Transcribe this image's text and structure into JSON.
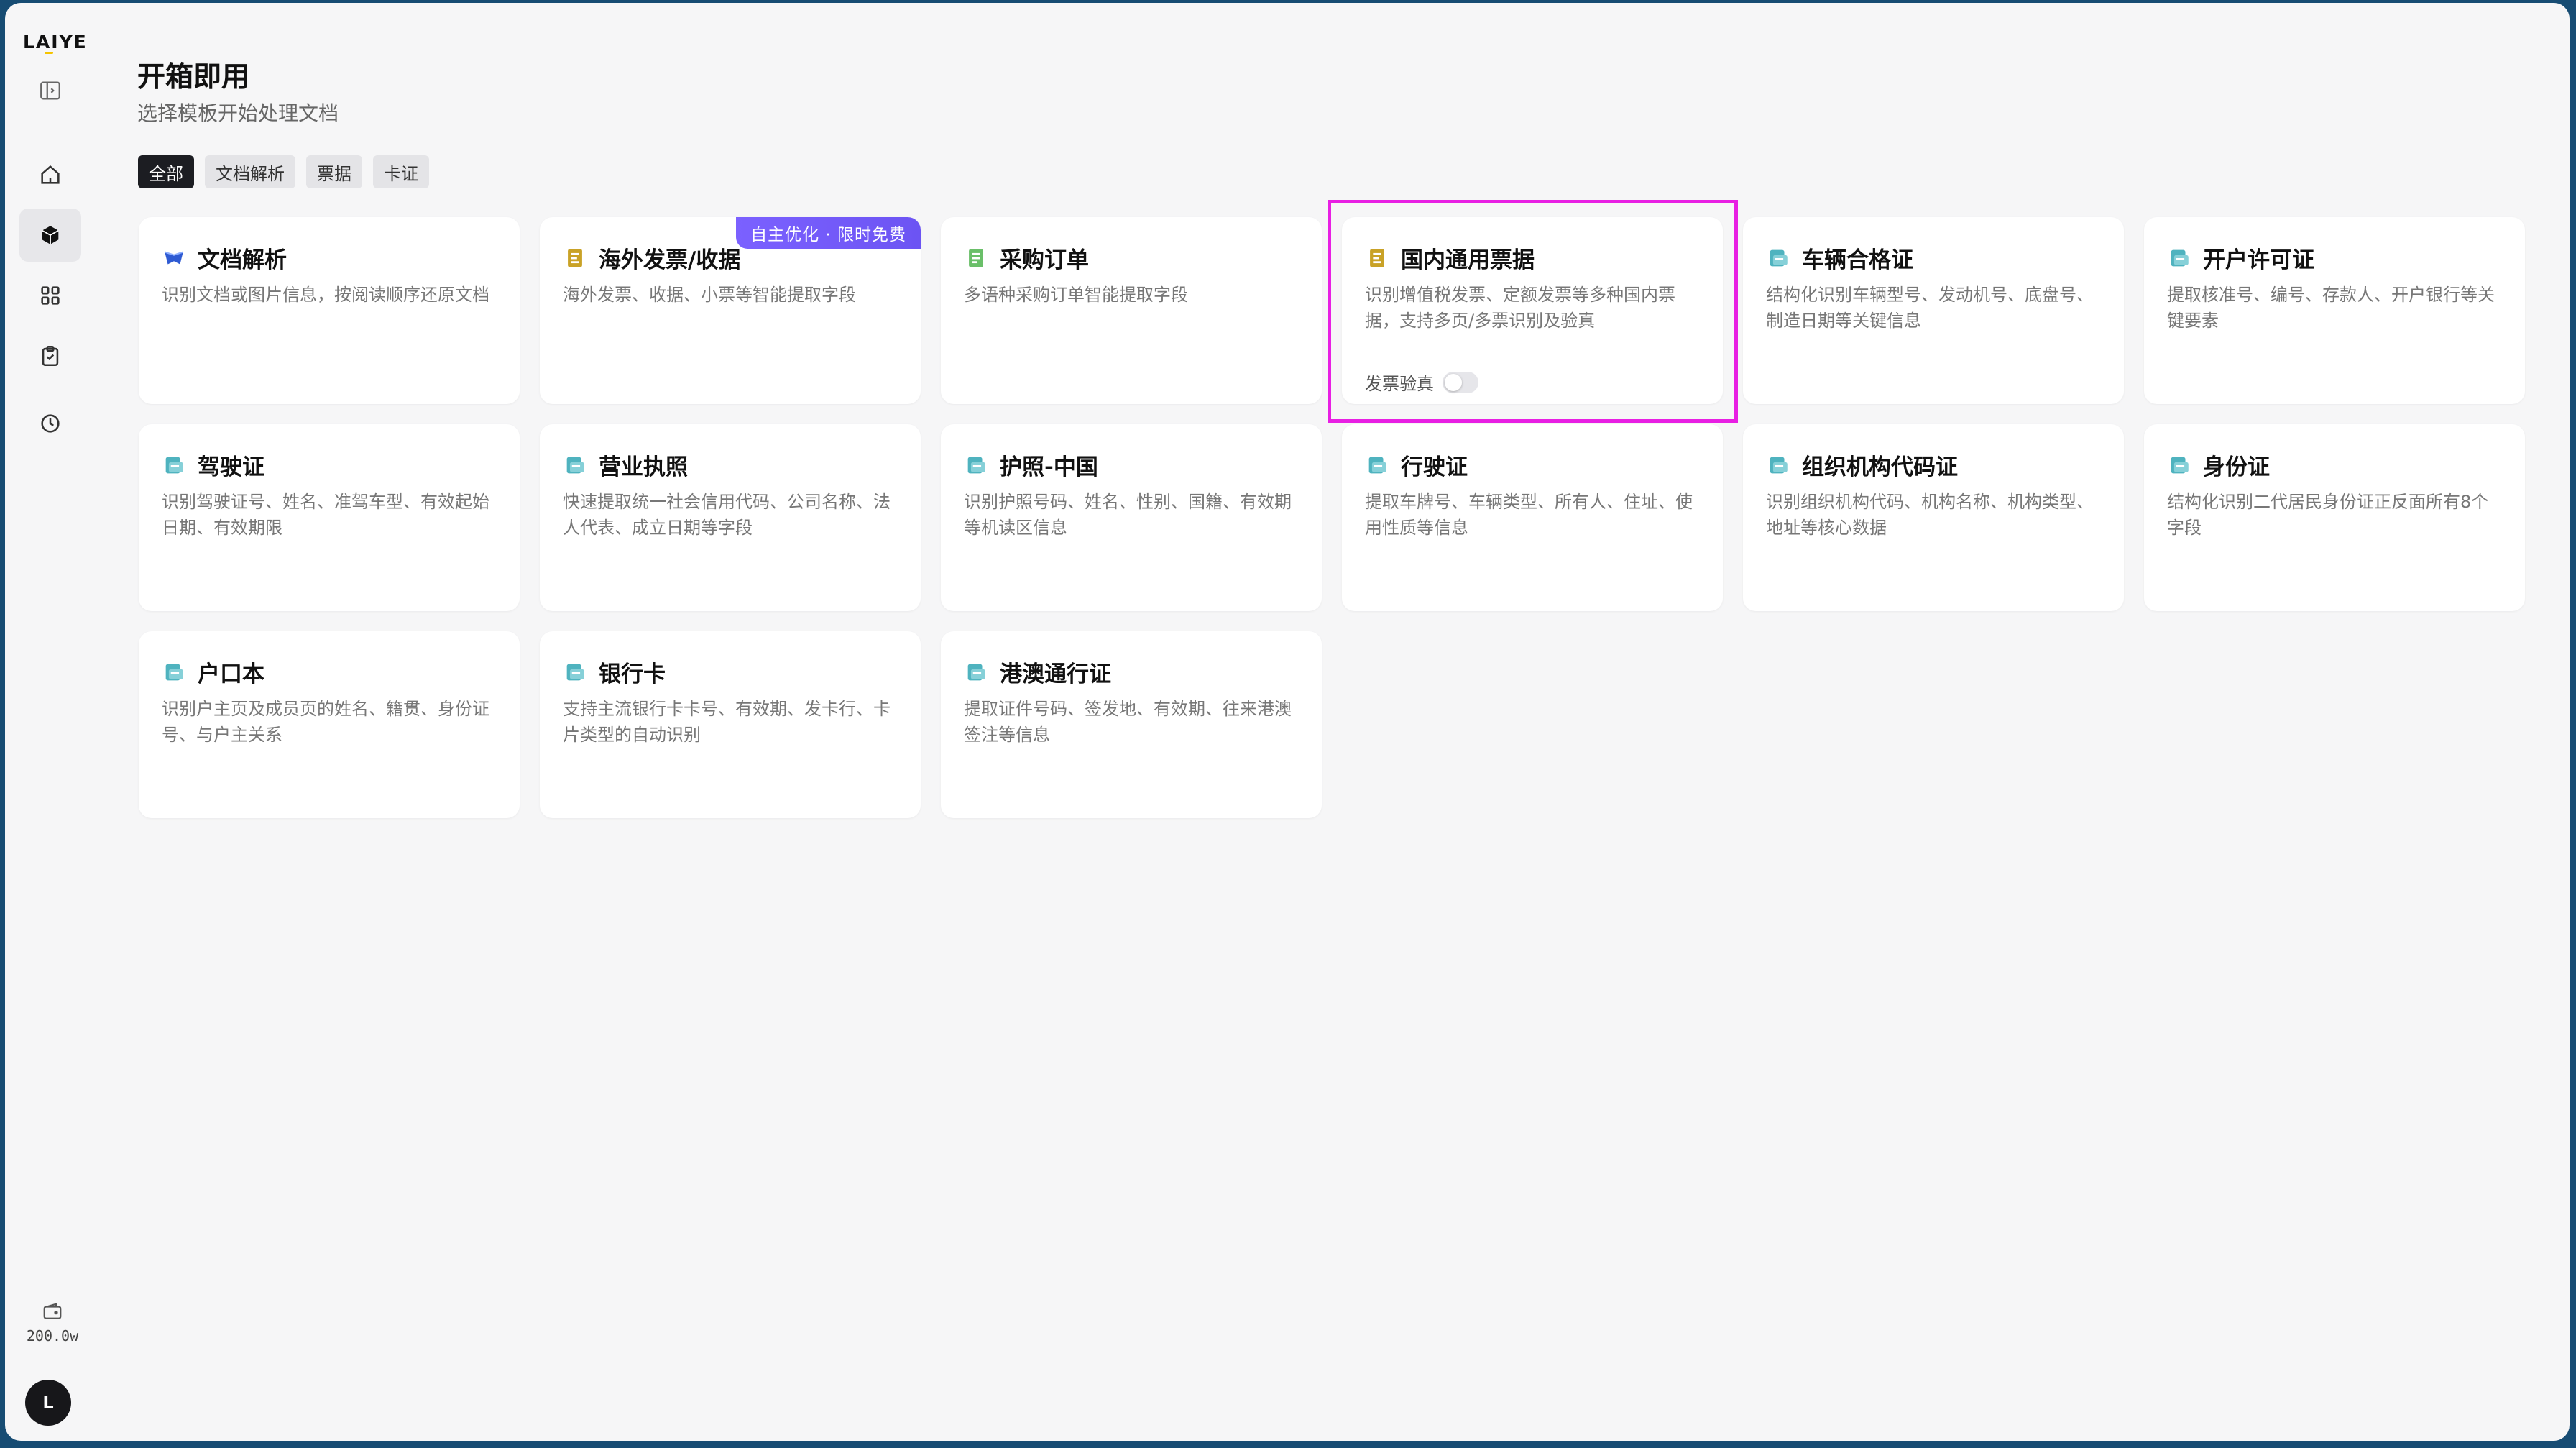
{
  "app": {
    "logo": "LAIYE"
  },
  "sidebar": {
    "items": [
      {
        "icon": "panel-toggle-icon"
      },
      {
        "icon": "home-icon"
      },
      {
        "icon": "cube-icon",
        "active": true
      },
      {
        "icon": "grid-icon"
      },
      {
        "icon": "clipboard-check-icon"
      },
      {
        "icon": "clock-icon"
      }
    ],
    "wallet_amount": "200.0w",
    "avatar_letter": "L"
  },
  "header": {
    "title": "开箱即用",
    "subtitle": "选择模板开始处理文档"
  },
  "filters": [
    "全部",
    "文档解析",
    "票据",
    "卡证"
  ],
  "active_filter": "全部",
  "cards": [
    {
      "title": "文档解析",
      "desc": "识别文档或图片信息，按阅读顺序还原文档",
      "icon": "document-parse-icon"
    },
    {
      "title": "海外发票/收据",
      "desc": "海外发票、收据、小票等智能提取字段",
      "icon": "invoice-icon",
      "badge": "自主优化 · 限时免费"
    },
    {
      "title": "采购订单",
      "desc": "多语种采购订单智能提取字段",
      "icon": "purchase-order-icon"
    },
    {
      "title": "国内通用票据",
      "desc": "识别增值税发票、定额发票等多种国内票据，支持多页/多票识别及验真",
      "icon": "invoice-icon",
      "toggle_label": "发票验真",
      "toggle_on": false
    },
    {
      "title": "车辆合格证",
      "desc": "结构化识别车辆型号、发动机号、底盘号、制造日期等关键信息",
      "icon": "card-icon"
    },
    {
      "title": "开户许可证",
      "desc": "提取核准号、编号、存款人、开户银行等关键要素",
      "icon": "card-icon"
    },
    {
      "title": "驾驶证",
      "desc": "识别驾驶证号、姓名、准驾车型、有效起始日期、有效期限",
      "icon": "card-icon"
    },
    {
      "title": "营业执照",
      "desc": "快速提取统一社会信用代码、公司名称、法人代表、成立日期等字段",
      "icon": "card-icon"
    },
    {
      "title": "护照-中国",
      "desc": "识别护照号码、姓名、性别、国籍、有效期等机读区信息",
      "icon": "card-icon"
    },
    {
      "title": "行驶证",
      "desc": "提取车牌号、车辆类型、所有人、住址、使用性质等信息",
      "icon": "card-icon"
    },
    {
      "title": "组织机构代码证",
      "desc": "识别组织机构代码、机构名称、机构类型、地址等核心数据",
      "icon": "card-icon"
    },
    {
      "title": "身份证",
      "desc": "结构化识别二代居民身份证正反面所有8个字段",
      "icon": "card-icon"
    },
    {
      "title": "户口本",
      "desc": "识别户主页及成员页的姓名、籍贯、身份证号、与户主关系",
      "icon": "card-icon"
    },
    {
      "title": "银行卡",
      "desc": "支持主流银行卡卡号、有效期、发卡行、卡片类型的自动识别",
      "icon": "card-icon"
    },
    {
      "title": "港澳通行证",
      "desc": "提取证件号码、签发地、有效期、往来港澳签注等信息",
      "icon": "card-icon"
    }
  ],
  "colors": {
    "accent_badge": "#7b61ff",
    "highlight": "#e81fe3",
    "card_icon_teal": "#4fb3bf",
    "invoice_icon_gold": "#c9a227",
    "order_icon_green": "#6abf69",
    "doc_icon_blue": "#2f5bd3"
  }
}
